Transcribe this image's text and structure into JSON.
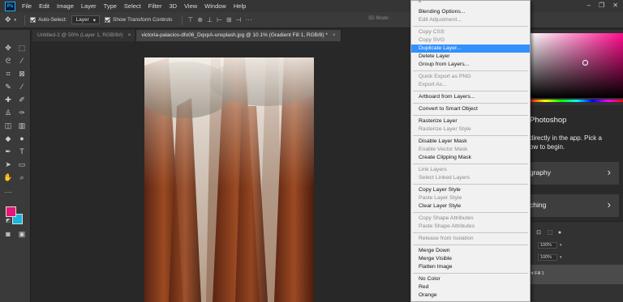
{
  "menubar": {
    "logo": "Ps",
    "items": [
      "File",
      "Edit",
      "Image",
      "Layer",
      "Type",
      "Select",
      "Filter",
      "3D",
      "View",
      "Window",
      "Help"
    ]
  },
  "options": {
    "auto_select_label": "Auto-Select:",
    "auto_select_value": "Layer",
    "transform_label": "Show Transform Controls",
    "mode_3d": "3D Mode:"
  },
  "tabs": [
    {
      "label": "Untitled-2 @ 50% (Layer 1, RGB/8#)",
      "close": "×"
    },
    {
      "label": "victoria-palacios-dfo06_DqxpA-unsplash.jpg @ 10.1% (Gradient Fill 1, RGB/8) *",
      "close": "×"
    }
  ],
  "context_menu": {
    "scroll_up": "^",
    "items": [
      {
        "label": "Blending Options...",
        "state": "normal"
      },
      {
        "label": "Edit Adjustment...",
        "state": "disabled"
      },
      {
        "sep": true
      },
      {
        "label": "Copy CSS",
        "state": "disabled"
      },
      {
        "label": "Copy SVG",
        "state": "disabled"
      },
      {
        "label": "Duplicate Layer...",
        "state": "highlight"
      },
      {
        "label": "Delete Layer",
        "state": "normal"
      },
      {
        "label": "Group from Layers...",
        "state": "normal"
      },
      {
        "sep": true
      },
      {
        "label": "Quick Export as PNG",
        "state": "disabled"
      },
      {
        "label": "Export As...",
        "state": "disabled"
      },
      {
        "sep": true
      },
      {
        "label": "Artboard from Layers...",
        "state": "normal"
      },
      {
        "sep": true
      },
      {
        "label": "Convert to Smart Object",
        "state": "normal"
      },
      {
        "sep": true
      },
      {
        "label": "Rasterize Layer",
        "state": "normal"
      },
      {
        "label": "Rasterize Layer Style",
        "state": "disabled"
      },
      {
        "sep": true
      },
      {
        "label": "Disable Layer Mask",
        "state": "normal"
      },
      {
        "label": "Enable Vector Mask",
        "state": "disabled"
      },
      {
        "label": "Create Clipping Mask",
        "state": "normal"
      },
      {
        "sep": true
      },
      {
        "label": "Link Layers",
        "state": "disabled"
      },
      {
        "label": "Select Linked Layers",
        "state": "disabled"
      },
      {
        "sep": true
      },
      {
        "label": "Copy Layer Style",
        "state": "normal"
      },
      {
        "label": "Paste Layer Style",
        "state": "disabled"
      },
      {
        "label": "Clear Layer Style",
        "state": "normal"
      },
      {
        "sep": true
      },
      {
        "label": "Copy Shape Attributes",
        "state": "disabled"
      },
      {
        "label": "Paste Shape Attributes",
        "state": "disabled"
      },
      {
        "sep": true
      },
      {
        "label": "Release from Isolation",
        "state": "disabled"
      },
      {
        "sep": true
      },
      {
        "label": "Merge Down",
        "state": "normal"
      },
      {
        "label": "Merge Visible",
        "state": "normal"
      },
      {
        "label": "Flatten Image",
        "state": "normal"
      },
      {
        "sep": true
      },
      {
        "label": "No Color",
        "state": "normal"
      },
      {
        "label": "Red",
        "state": "normal"
      },
      {
        "label": "Orange",
        "state": "normal"
      }
    ]
  },
  "learn": {
    "title": "Photoshop",
    "desc": "directly in the app. Pick a\now to begin.",
    "card1": "graphy",
    "card2": "ching",
    "chevron": "›"
  },
  "layers": {
    "opacity": "100%",
    "fill": "100%",
    "layer_name": "nt Fill 1"
  },
  "colors": {
    "foreground": "#e5157a",
    "background": "#17b6dd",
    "highlight": "#3390ff"
  }
}
